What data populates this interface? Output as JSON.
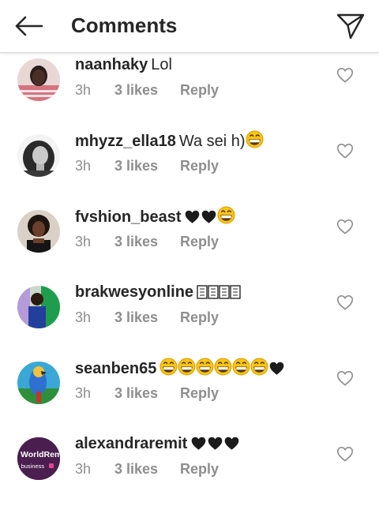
{
  "header": {
    "title": "Comments",
    "back_icon": "arrow-left-icon",
    "share_icon": "paper-plane-icon"
  },
  "colors": {
    "text": "#262626",
    "meta": "#8e8e8e",
    "divider": "#dbdbdb",
    "emoji_face": "#f7c417"
  },
  "comments": [
    {
      "username": "naanhaky",
      "text": "Lol",
      "emojis": [],
      "time": "3h",
      "likes": "3 likes",
      "reply": "Reply"
    },
    {
      "username": "mhyzz_ella18",
      "text": "Wa sei h)",
      "emojis": [
        "grin-emoji"
      ],
      "time": "3h",
      "likes": "3 likes",
      "reply": "Reply"
    },
    {
      "username": "fvshion_beast",
      "text": "",
      "emojis": [
        "black-heart-emoji",
        "black-heart-emoji",
        "grin-emoji"
      ],
      "time": "3h",
      "likes": "3 likes",
      "reply": "Reply"
    },
    {
      "username": "brakwesyonline",
      "text": "",
      "emojis": [
        "missing-glyph",
        "missing-glyph",
        "missing-glyph",
        "missing-glyph"
      ],
      "time": "3h",
      "likes": "3 likes",
      "reply": "Reply"
    },
    {
      "username": "seanben65",
      "text": "",
      "emojis": [
        "grin-emoji",
        "grin-emoji",
        "grin-emoji",
        "grin-emoji",
        "grin-emoji",
        "grin-emoji",
        "black-heart-emoji"
      ],
      "time": "3h",
      "likes": "3 likes",
      "reply": "Reply"
    },
    {
      "username": "alexandraremit",
      "text": "",
      "emojis": [
        "black-heart-emoji",
        "black-heart-emoji",
        "black-heart-emoji"
      ],
      "time": "3h",
      "likes": "3 likes",
      "reply": "Reply",
      "avatar_logo_text": [
        "WorldRem",
        "r business"
      ]
    }
  ]
}
